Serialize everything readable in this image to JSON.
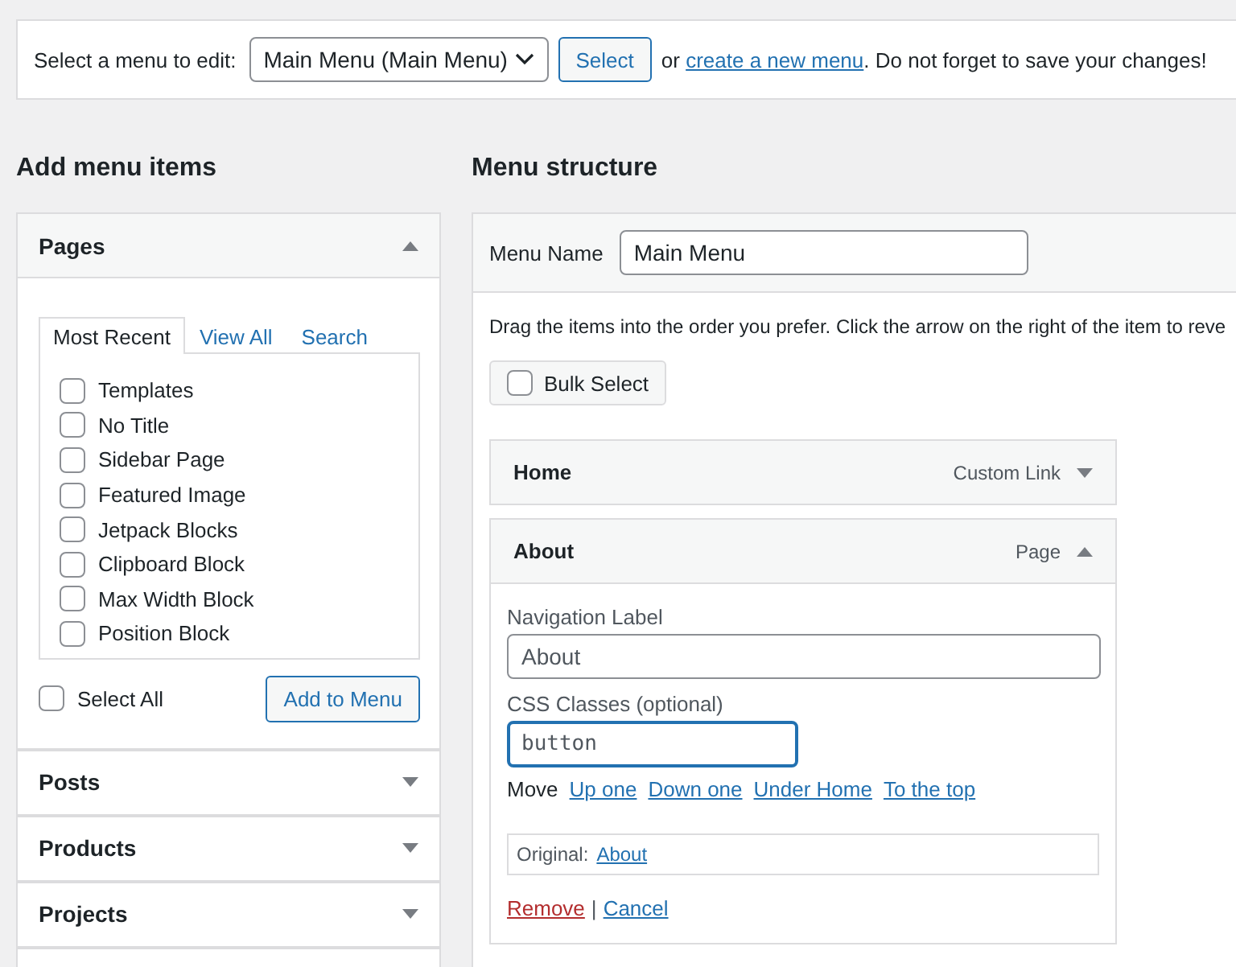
{
  "menu_selector": {
    "label": "Select a menu to edit:",
    "value": "Main Menu (Main Menu)",
    "button": "Select",
    "text_before_link": "or",
    "link": "create a new menu",
    "text_after_link": ". Do not forget to save your changes!"
  },
  "add_menu_items": {
    "title": "Add menu items",
    "panels": [
      {
        "title": "Pages",
        "expanded": true,
        "tabs": [
          {
            "label": "Most Recent",
            "selected": true
          },
          {
            "label": "View All",
            "selected": false
          },
          {
            "label": "Search",
            "selected": false
          }
        ],
        "items": [
          {
            "label": "Templates",
            "checked": false
          },
          {
            "label": "No Title",
            "checked": false
          },
          {
            "label": "Sidebar Page",
            "checked": false
          },
          {
            "label": "Featured Image",
            "checked": false
          },
          {
            "label": "Jetpack Blocks",
            "checked": false
          },
          {
            "label": "Clipboard Block",
            "checked": false
          },
          {
            "label": "Max Width Block",
            "checked": false
          },
          {
            "label": "Position Block",
            "checked": false
          }
        ],
        "select_all": {
          "label": "Select All",
          "checked": false
        },
        "button": "Add to Menu"
      },
      {
        "title": "Posts",
        "expanded": false
      },
      {
        "title": "Products",
        "expanded": false
      },
      {
        "title": "Projects",
        "expanded": false
      }
    ]
  },
  "menu_structure": {
    "title": "Menu structure",
    "menu_name": {
      "label": "Menu Name",
      "value": "Main Menu"
    },
    "instructions": "Drag the items into the order you prefer. Click the arrow on the right of the item to reve",
    "bulk_select": {
      "label": "Bulk Select",
      "checked": false
    },
    "items": [
      {
        "title": "Home",
        "type": "Custom Link",
        "expanded": false
      },
      {
        "title": "About",
        "type": "Page",
        "expanded": true,
        "navigation_label": {
          "label": "Navigation Label",
          "value": "About"
        },
        "css_classes": {
          "label": "CSS Classes (optional)",
          "value": "button",
          "focused": true
        },
        "move": {
          "label": "Move",
          "links": [
            "Up one",
            "Down one",
            "Under Home",
            "To the top"
          ]
        },
        "original": {
          "label": "Original:",
          "link": "About"
        },
        "remove": "Remove",
        "separator": "|",
        "cancel": "Cancel"
      }
    ]
  }
}
